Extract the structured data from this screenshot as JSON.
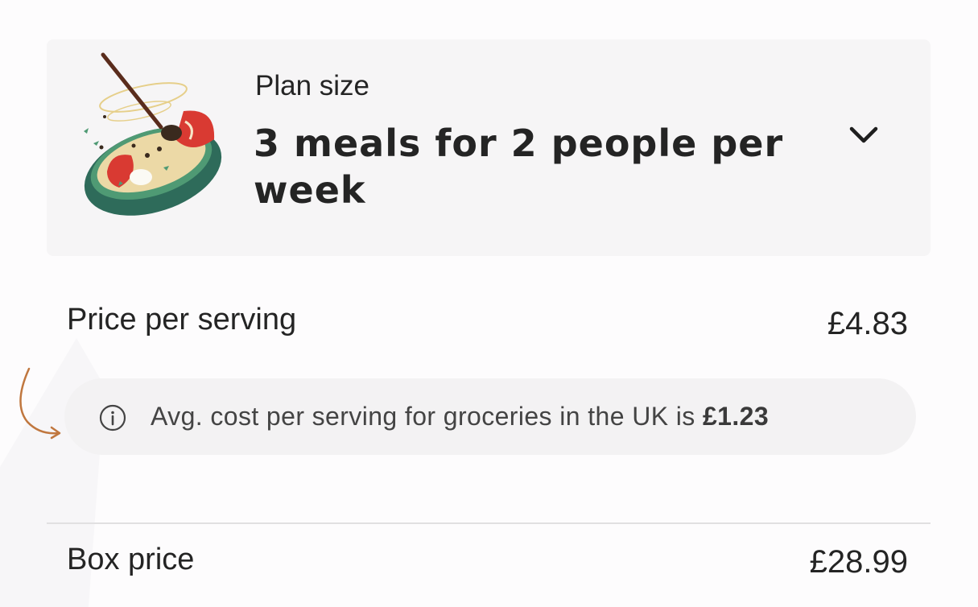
{
  "plan": {
    "label": "Plan size",
    "value": "3 meals for 2 people per week",
    "dropdown_icon": "chevron-down-icon",
    "illustration": "bowl-with-spoon-illustration"
  },
  "pricing": {
    "price_per_serving_label": "Price per serving",
    "price_per_serving_value": "£4.83",
    "info_icon": "info-icon",
    "info_text_prefix": "Avg. cost per serving for groceries in the UK is ",
    "info_text_amount": "£1.23",
    "box_price_label": "Box price",
    "box_price_value": "£28.99"
  },
  "colors": {
    "card_background": "#f6f5f6",
    "info_background": "#f3f2f3",
    "text": "#242424",
    "arrow_doodle": "#c0773f",
    "bowl_green": "#2e6b5a",
    "tomato_red": "#d93a32"
  }
}
